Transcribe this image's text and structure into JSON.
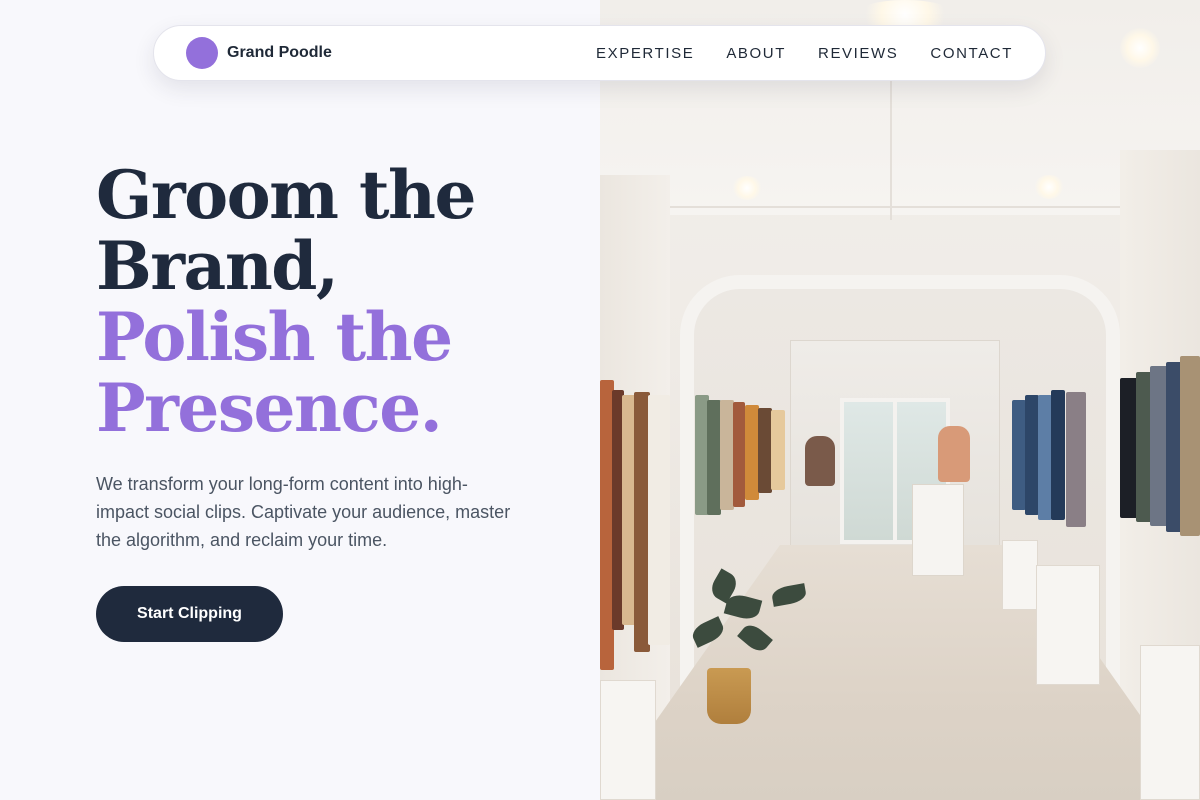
{
  "brand": {
    "name": "Grand Poodle",
    "logo_color": "#9370db"
  },
  "nav": {
    "links": [
      "EXPERTISE",
      "ABOUT",
      "REVIEWS",
      "CONTACT"
    ]
  },
  "hero": {
    "title_line1": "Groom the",
    "title_line2": "Brand,",
    "accent_line1": "Polish the",
    "accent_line2": "Presence.",
    "subtitle": "We transform your long-form content into high-impact social clips. Captivate your audience, master the algorithm, and reclaim your time.",
    "cta_label": "Start Clipping"
  },
  "image": {
    "subject": "clothing-store-interior"
  },
  "colors": {
    "accent": "#9370db",
    "dark": "#1f2a3d",
    "background": "#f8f8fc"
  }
}
